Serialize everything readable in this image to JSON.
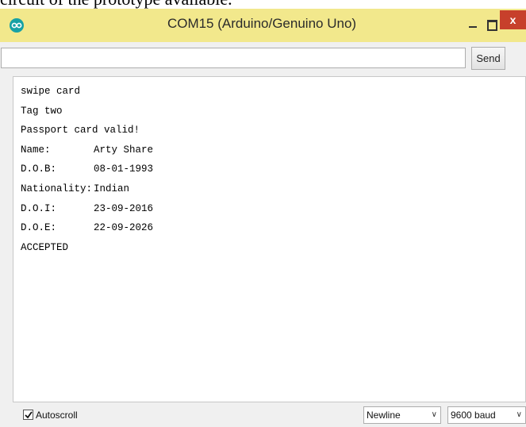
{
  "caption": "circuit of the prototype available.",
  "window": {
    "title": "COM15 (Arduino/Genuino Uno)",
    "icons": {
      "app": "arduino-logo-icon",
      "minimize": "minimize-icon",
      "maximize": "maximize-icon",
      "close": "close-icon"
    },
    "close_glyph": "x",
    "colors": {
      "titlebar": "#f2e88c",
      "close": "#c7402b",
      "app_icon": "#17a1a5"
    }
  },
  "send": {
    "input_value": "",
    "button_label": "Send"
  },
  "output": {
    "lines": [
      {
        "text": "swipe card"
      },
      {
        "text": "Tag two"
      },
      {
        "text": "Passport card valid!"
      },
      {
        "label": "Name:",
        "value": "Arty Share"
      },
      {
        "label": "D.O.B:",
        "value": "08-01-1993"
      },
      {
        "label": "Nationality:",
        "value": "Indian"
      },
      {
        "label": "D.O.I:",
        "value": "23-09-2016"
      },
      {
        "label": "D.O.E:",
        "value": "22-09-2026"
      },
      {
        "text": "ACCEPTED"
      }
    ]
  },
  "bottom": {
    "autoscroll_label": "Autoscroll",
    "autoscroll_checked": true,
    "line_ending": "Newline",
    "baud_rate": "9600 baud"
  }
}
